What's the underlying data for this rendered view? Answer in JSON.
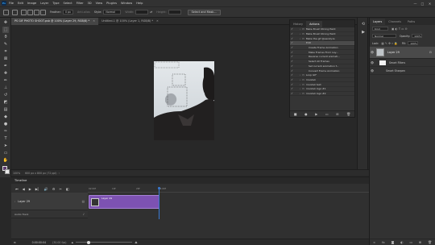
{
  "menu": [
    "File",
    "Edit",
    "Image",
    "Layer",
    "Type",
    "Select",
    "Filter",
    "3D",
    "View",
    "Plugins",
    "Window",
    "Help"
  ],
  "window_controls": [
    "—",
    "□",
    "✕"
  ],
  "options_bar": {
    "feather_label": "Feather:",
    "feather_value": "0 px",
    "antialias_label": "Anti-alias",
    "style_label": "Style:",
    "style_value": "Normal",
    "width_label": "Width:",
    "height_label": "Height:",
    "select_mask_button": "Select and Mask..."
  },
  "doc_tabs": [
    {
      "label": "PS GIF PHOTO SHOOT.psb @ 100% (Layer 29, RGB/8) *",
      "active": true
    },
    {
      "label": "Untitled-1 @ 100% (Layer 1, RGB/8) *",
      "active": false
    }
  ],
  "status": {
    "zoom": "100%",
    "doc_size": "600 px x 800 px (72 ppi)"
  },
  "actions_panel": {
    "tabs": [
      "History",
      "Actions"
    ],
    "active_tab": "Actions",
    "rows": [
      {
        "label": "Make Brush Strong Paint",
        "level": 1,
        "folder": true,
        "highlight": false
      },
      {
        "label": "Make Brush Strong Paint",
        "level": 1,
        "folder": true,
        "highlight": false
      },
      {
        "label": "Make the gif @wendy1s",
        "level": 1,
        "folder": true,
        "highlight": false
      },
      {
        "label": "Edit",
        "level": 2,
        "folder": false,
        "highlight": true
      },
      {
        "label": "Create Frame Animation",
        "level": 3,
        "folder": false,
        "highlight": false
      },
      {
        "label": "Make Frames From Lay...",
        "level": 3,
        "folder": false,
        "highlight": false
      },
      {
        "label": "Reverse current animati...",
        "level": 3,
        "folder": false,
        "highlight": false
      },
      {
        "label": "Select All Frames",
        "level": 3,
        "folder": false,
        "highlight": false
      },
      {
        "label": "Set current animation f...",
        "level": 3,
        "folder": false,
        "highlight": false
      },
      {
        "label": "Convert Frame Animation",
        "level": 3,
        "folder": false,
        "highlight": false
      },
      {
        "label": "Loop GIF",
        "level": 1,
        "folder": true,
        "highlight": false
      },
      {
        "label": "moodeli",
        "level": 1,
        "folder": true,
        "highlight": false
      },
      {
        "label": "moodeli text",
        "level": 1,
        "folder": true,
        "highlight": false
      },
      {
        "label": "moodeli logo #1",
        "level": 1,
        "folder": true,
        "highlight": false
      },
      {
        "label": "moodeli logo #2",
        "level": 1,
        "folder": true,
        "highlight": false
      }
    ]
  },
  "layers_panel": {
    "tabs": [
      "Layers",
      "Channels",
      "Paths"
    ],
    "active_tab": "Layers",
    "filter_label": "Kind",
    "blend_mode": "Normal",
    "opacity_label": "Opacity:",
    "opacity_value": "100%",
    "lock_label": "Lock:",
    "fill_label": "Fill:",
    "fill_value": "100%",
    "layers": [
      {
        "name": "Layer 29",
        "selected": true
      }
    ],
    "sub_items": [
      "Smart Filters",
      "Smart Sharpen"
    ]
  },
  "timeline": {
    "title": "Timeline",
    "track_name": "Layer 29",
    "audio_track": "Audio Track",
    "clip_label": "Layer 29",
    "timecode": "0:00:00:04",
    "fps": "(30.00 fps)",
    "ruler": [
      "02:00f",
      "10f",
      "20f",
      "01:00f"
    ]
  },
  "colors": {
    "accent": "#31a8ff",
    "clip": "#7d52b2",
    "playhead": "#3a7bd5"
  }
}
